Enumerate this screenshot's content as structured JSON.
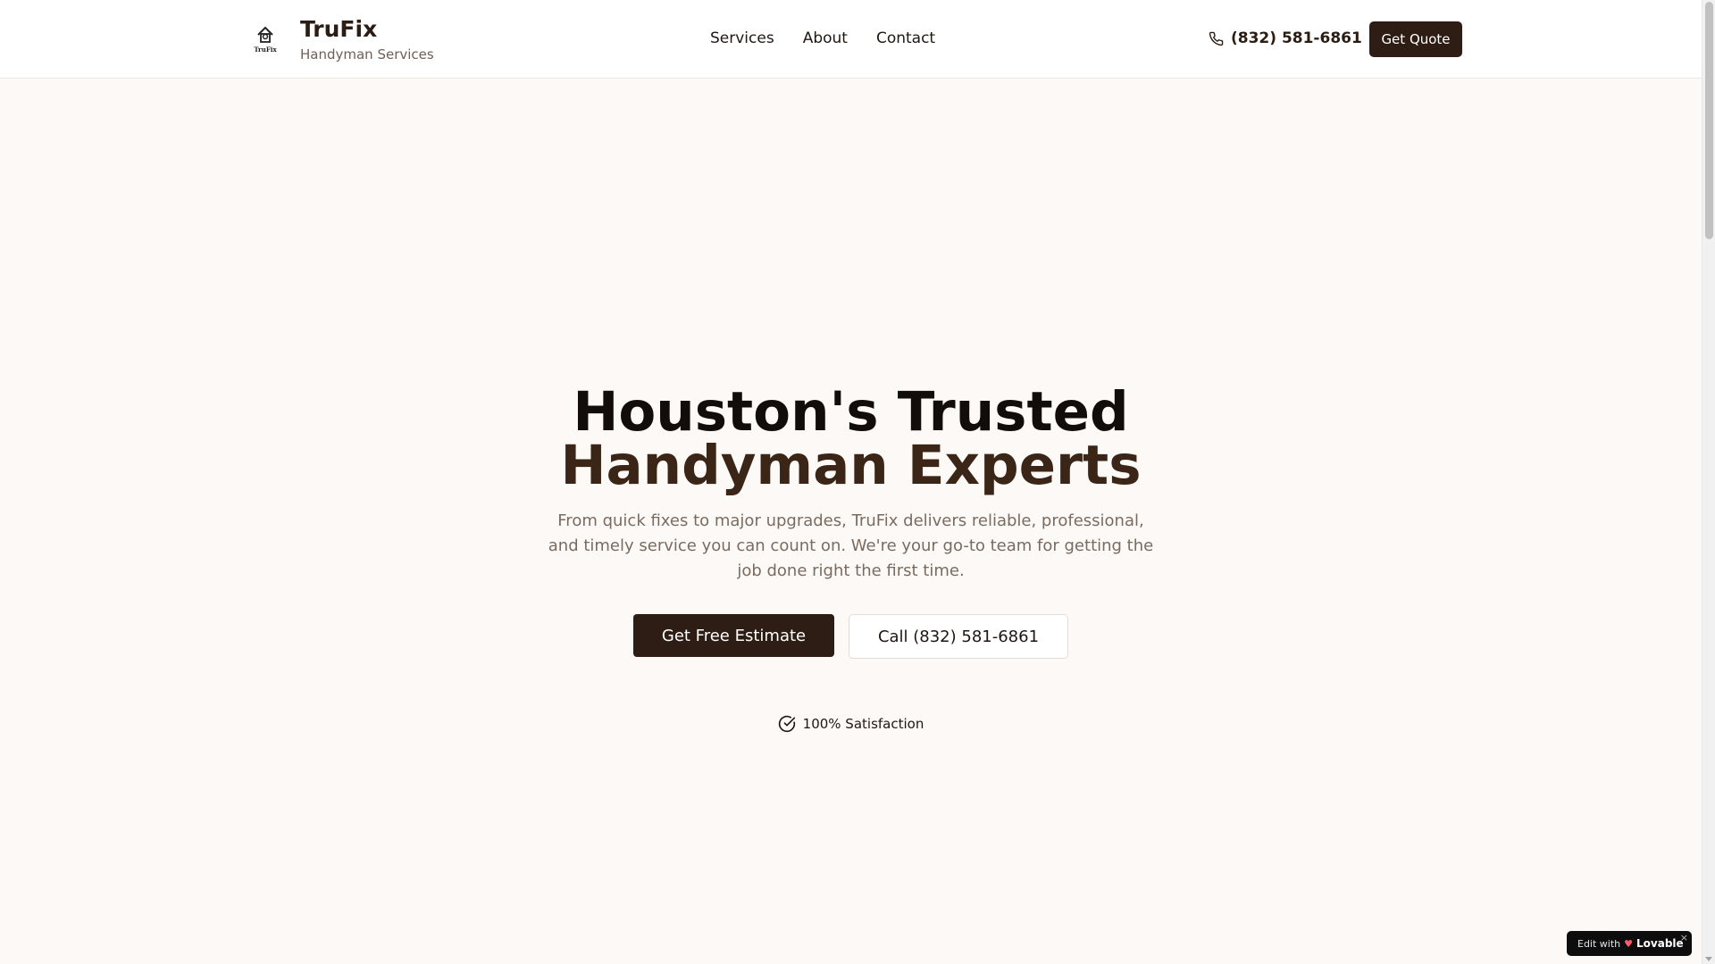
{
  "header": {
    "logo_text": "TruFix",
    "brand_name": "TruFix",
    "brand_sub": "Handyman Services",
    "nav": [
      "Services",
      "About",
      "Contact"
    ],
    "phone_icon": "phone-icon",
    "phone": "(832) 581-6861",
    "quote_button": "Get Quote"
  },
  "hero": {
    "headline_line1": "Houston's Trusted",
    "headline_line2": "Handyman Experts",
    "lede": "From quick fixes to major upgrades, TruFix delivers reliable, professional, and timely service you can count on. We're your go-to team for getting the job done right the first time.",
    "cta_primary": "Get Free Estimate",
    "cta_secondary": "Call (832) 581-6861",
    "satisfaction_icon": "check-circle-icon",
    "satisfaction_text": "100% Satisfaction"
  },
  "badge": {
    "edit_with": "Edit with",
    "brand": "Lovable",
    "close": "×"
  },
  "colors": {
    "brand_dark": "#2e1d14",
    "background": "#fdf9f6",
    "muted_text": "#7a6b61"
  }
}
